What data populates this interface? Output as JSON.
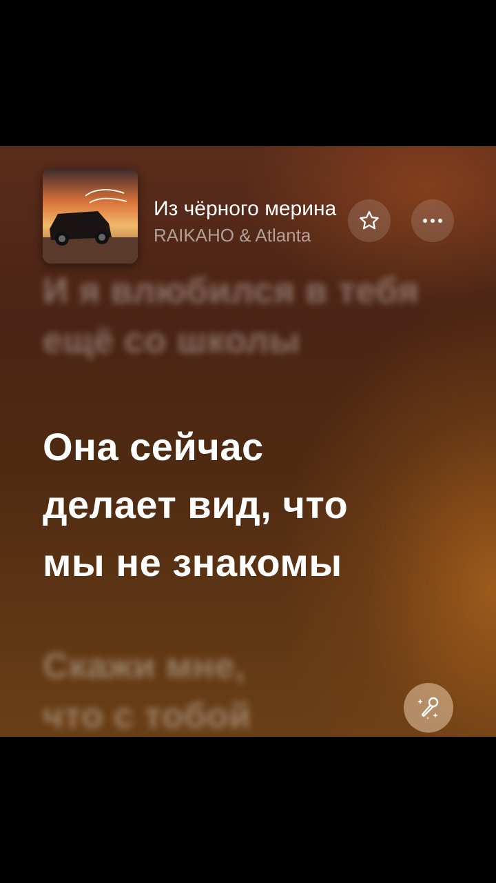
{
  "player": {
    "track_title": "Из чёрного мерина",
    "artist": "RAIKAHO & Atlanta"
  },
  "icons": {
    "favorite": "star-outline-icon",
    "more": "more-horizontal-icon",
    "karaoke": "microphone-sparkle-icon"
  },
  "lyrics": {
    "previous": [
      "И я влюбился в тебя",
      "ещё со школы"
    ],
    "current": [
      "Она сейчас",
      "делает вид, что",
      "мы не знакомы"
    ],
    "next": [
      "Скажи мне,",
      "что с тобой"
    ]
  },
  "colors": {
    "background": "#4f2a12",
    "accent": "#a8621c"
  }
}
